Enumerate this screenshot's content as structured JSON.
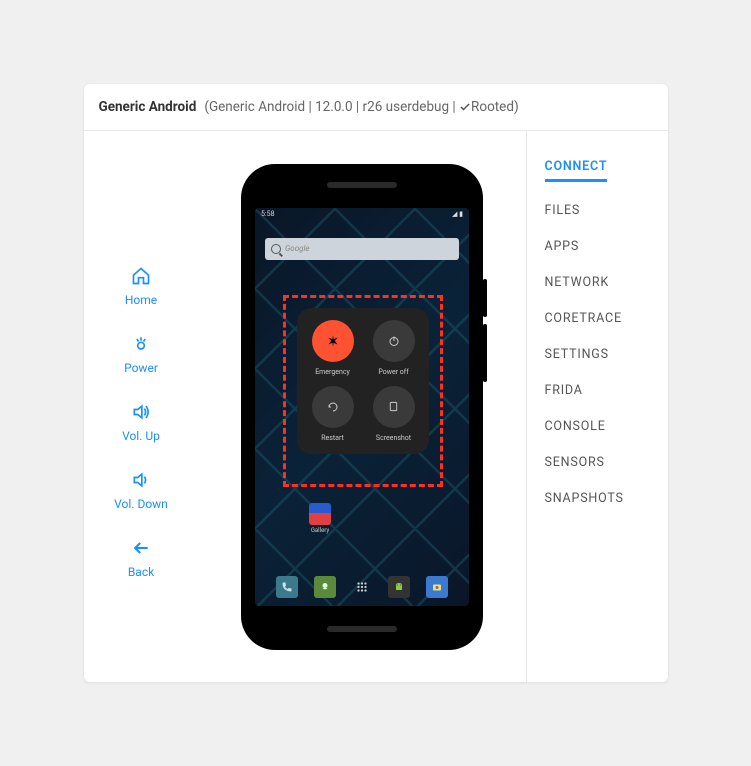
{
  "header": {
    "device_name": "Generic Android",
    "meta_prefix": "(Generic Android | 12.0.0 | r26 userdebug | ",
    "rooted_label": "Rooted)",
    "meta_suffix": ""
  },
  "left_controls": [
    {
      "id": "home",
      "label": "Home"
    },
    {
      "id": "power",
      "label": "Power"
    },
    {
      "id": "volup",
      "label": "Vol. Up"
    },
    {
      "id": "voldown",
      "label": "Vol. Down"
    },
    {
      "id": "back",
      "label": "Back"
    }
  ],
  "status_bar": {
    "time": "5:58",
    "right_icons": "◢ ▮"
  },
  "search": {
    "placeholder": "Google"
  },
  "power_menu": [
    {
      "id": "emergency",
      "label": "Emergency",
      "color": "#ff5233",
      "icon": "asterisk"
    },
    {
      "id": "poweroff",
      "label": "Power off",
      "color": "#3a3a3a",
      "icon": "power"
    },
    {
      "id": "restart",
      "label": "Restart",
      "color": "#3a3a3a",
      "icon": "restart"
    },
    {
      "id": "screenshot",
      "label": "Screenshot",
      "color": "#3a3a3a",
      "icon": "screenshot"
    }
  ],
  "home_apps": {
    "gallery": "Gallery"
  },
  "dock": [
    {
      "id": "phone",
      "bg": "#3a7a8a"
    },
    {
      "id": "messages",
      "bg": "#5a8a3a"
    },
    {
      "id": "drawer",
      "bg": "transparent"
    },
    {
      "id": "android",
      "bg": "#333"
    },
    {
      "id": "camera",
      "bg": "#3a7ad0"
    }
  ],
  "right_menu": [
    {
      "id": "connect",
      "label": "CONNECT",
      "active": true
    },
    {
      "id": "files",
      "label": "FILES",
      "active": false
    },
    {
      "id": "apps",
      "label": "APPS",
      "active": false
    },
    {
      "id": "network",
      "label": "NETWORK",
      "active": false
    },
    {
      "id": "coretrace",
      "label": "CORETRACE",
      "active": false
    },
    {
      "id": "settings",
      "label": "SETTINGS",
      "active": false
    },
    {
      "id": "frida",
      "label": "FRIDA",
      "active": false
    },
    {
      "id": "console",
      "label": "CONSOLE",
      "active": false
    },
    {
      "id": "sensors",
      "label": "SENSORS",
      "active": false
    },
    {
      "id": "snapshots",
      "label": "SNAPSHOTS",
      "active": false
    }
  ],
  "colors": {
    "accent": "#1890ff",
    "highlight_dash": "#ff3020"
  }
}
